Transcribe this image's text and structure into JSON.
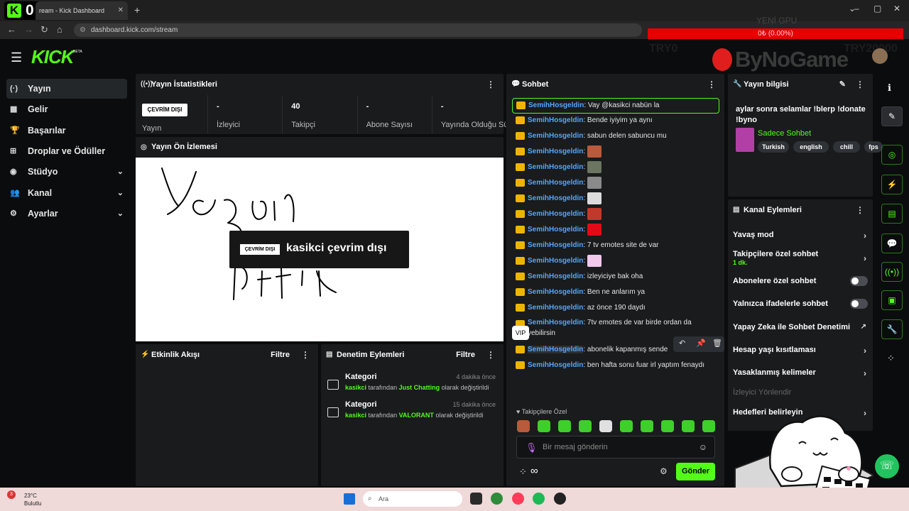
{
  "browser": {
    "badge_letter": "K",
    "badge_count": "0",
    "tab_title": "ream - Kick Dashboard",
    "url": "dashboard.kick.com/stream"
  },
  "overlay": {
    "gpu_label": "YENİ GPU",
    "progress_text": "0₺ (0.00%)",
    "left_amount": "TRY0",
    "right_amount": "TRY20000",
    "brand": "ByNoGame"
  },
  "header": {
    "logo": "KICK",
    "beta": "BETA"
  },
  "sidebar": {
    "items": [
      {
        "label": "Yayın",
        "icon": "broadcast-icon",
        "glyph": "(·)",
        "active": true,
        "expandable": false
      },
      {
        "label": "Gelir",
        "icon": "revenue-icon",
        "glyph": "▦",
        "active": false,
        "expandable": false
      },
      {
        "label": "Başarılar",
        "icon": "trophy-icon",
        "glyph": "🏆",
        "active": false,
        "expandable": false
      },
      {
        "label": "Droplar ve Ödüller",
        "icon": "gift-icon",
        "glyph": "⊞",
        "active": false,
        "expandable": false
      },
      {
        "label": "Stüdyo",
        "icon": "studio-icon",
        "glyph": "◉",
        "active": false,
        "expandable": true
      },
      {
        "label": "Kanal",
        "icon": "channel-icon",
        "glyph": "👥",
        "active": false,
        "expandable": true
      },
      {
        "label": "Ayarlar",
        "icon": "settings-icon",
        "glyph": "⚙",
        "active": false,
        "expandable": true
      }
    ]
  },
  "stats": {
    "title": "Yayın İstatistikleri",
    "status_pill": "ÇEVRİM DIŞI",
    "status_label": "Yayın",
    "cells": [
      {
        "value": "-",
        "label": "İzleyici"
      },
      {
        "value": "40",
        "label": "Takipçi"
      },
      {
        "value": "-",
        "label": "Abone Sayısı"
      },
      {
        "value": "-",
        "label": "Yayında Olduğu Süre"
      }
    ]
  },
  "preview": {
    "title": "Yayın Ön İzlemesi",
    "offline_pill": "ÇEVRİM DIŞI",
    "offline_text": "kasikci çevrim dışı"
  },
  "activity": {
    "title": "Etkinlik Akışı",
    "filter": "Filtre"
  },
  "moderation": {
    "title": "Denetim Eylemleri",
    "filter": "Filtre",
    "items": [
      {
        "title": "Kategori",
        "time": "4 dakika önce",
        "user": "kasikci",
        "mid": "tarafından",
        "target": "Just Chatting",
        "tail": "olarak değiştirildi"
      },
      {
        "title": "Kategori",
        "time": "15 dakika önce",
        "user": "kasikci",
        "mid": "tarafından",
        "target": "VALORANT",
        "tail": "olarak değiştirildi"
      }
    ]
  },
  "chat": {
    "title": "Sohbet",
    "messages": [
      {
        "user": "SemihHosgeldin",
        "text": ": Vay @kasikci nabün la",
        "emote": "",
        "highlight": true
      },
      {
        "user": "SemihHosgeldin",
        "text": ": Bende iyiyim ya aynı",
        "emote": "",
        "highlight": false
      },
      {
        "user": "SemihHosgeldin",
        "text": ": sabun delen sabuncu mu",
        "emote": "",
        "highlight": false
      },
      {
        "user": "SemihHosgeldin",
        "text": ":",
        "emote": "#b85a3c",
        "highlight": false
      },
      {
        "user": "SemihHosgeldin",
        "text": ":",
        "emote": "#6b7560",
        "highlight": false
      },
      {
        "user": "SemihHosgeldin",
        "text": ":",
        "emote": "#8a8a8a",
        "highlight": false
      },
      {
        "user": "SemihHosgeldin",
        "text": ":",
        "emote": "#dcdcdc",
        "highlight": false
      },
      {
        "user": "SemihHosgeldin",
        "text": ":",
        "emote": "#c0392b",
        "highlight": false
      },
      {
        "user": "SemihHosgeldin",
        "text": ":",
        "emote": "#e30a17",
        "highlight": false
      },
      {
        "user": "SemihHosgeldin",
        "text": ": 7 tv emotes site de var",
        "emote": "",
        "highlight": false
      },
      {
        "user": "SemihHosgeldin",
        "text": ":",
        "emote": "#f1c7ec",
        "highlight": false
      },
      {
        "user": "SemihHosgeldin",
        "text": ": izleyiciye bak oha",
        "emote": "",
        "highlight": false
      },
      {
        "user": "SemihHosgeldin",
        "text": ": Ben ne anlarım ya",
        "emote": "",
        "highlight": false
      },
      {
        "user": "SemihHosgeldin",
        "text": ": az önce 190 daydı",
        "emote": "",
        "highlight": false
      }
    ],
    "wrapped_message": {
      "user": "SemihHosgeldin",
      "line1": ": 7tv emotes de var birde ordan da",
      "line2": "yebilirsin"
    },
    "vip_tooltip": "VIP",
    "hover_message": {
      "user": "SemihHosgeldin",
      "text": ": abonelik kapanmış sende"
    },
    "last_message": {
      "user": "SemihHosgeldin",
      "text": ": ben hafta sonu fuar irl yaptım fenaydı"
    },
    "follower_only_label": "Takipçilere Özel",
    "input_placeholder": "Bir mesaj gönderin",
    "infinity": "∞",
    "send_label": "Gönder"
  },
  "stream_info": {
    "title": "Yayın bilgisi",
    "stream_title": "aylar sonra selamlar !blerp !donate !byno",
    "category": "Sadece Sohbet",
    "tags": [
      "Turkish",
      "english",
      "chill",
      "fps"
    ]
  },
  "channel_actions": {
    "title": "Kanal Eylemleri",
    "items": [
      {
        "label": "Yavaş mod",
        "sub": "",
        "control": "chevron"
      },
      {
        "label": "Takipçilere özel sohbet",
        "sub": "1 dk.",
        "control": "chevron"
      },
      {
        "label": "Abonelere özel sohbet",
        "sub": "",
        "control": "toggle"
      },
      {
        "label": "Yalnızca ifadelerle sohbet",
        "sub": "",
        "control": "toggle"
      },
      {
        "label": "Yapay Zeka ile Sohbet Denetimi",
        "sub": "",
        "control": "external"
      },
      {
        "label": "Hesap yaşı kısıtlaması",
        "sub": "",
        "control": "chevron"
      },
      {
        "label": "Yasaklanmış kelimeler",
        "sub": "",
        "control": "chevron"
      },
      {
        "label": "İzleyici Yönlendir",
        "sub": "",
        "control": "none"
      },
      {
        "label": "Hedefleri belirleyin",
        "sub": "",
        "control": "chevron"
      }
    ]
  },
  "taskbar": {
    "weather_badge": "3",
    "temperature": "23°C",
    "condition": "Bulutlu",
    "search_placeholder": "Ara"
  },
  "colors": {
    "accent": "#53fc18",
    "panel": "#191b1d",
    "background": "#0b0c0d",
    "username": "#53a7ff",
    "offline_red": "#e60000"
  }
}
